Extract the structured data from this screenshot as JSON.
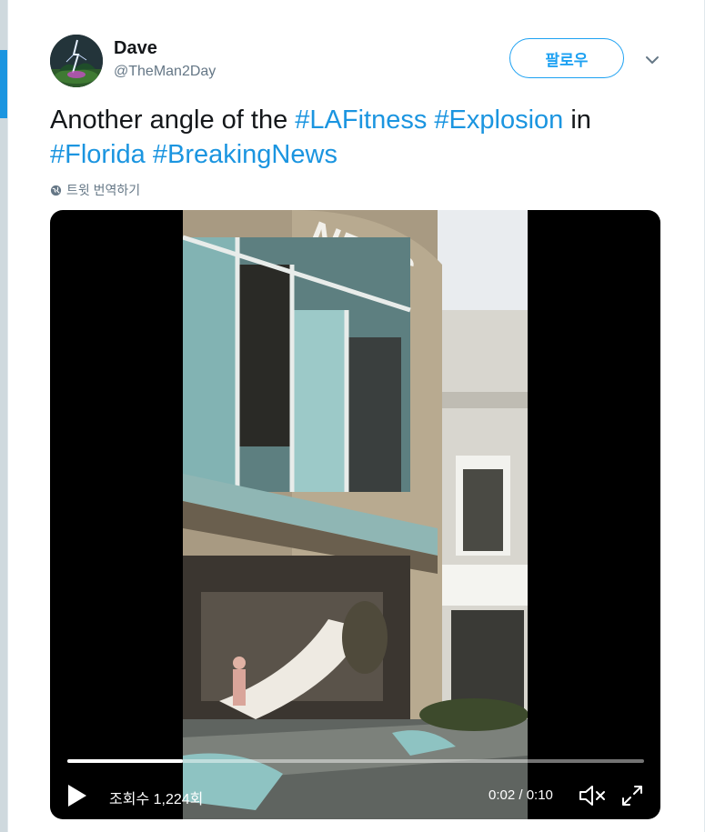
{
  "user": {
    "name": "Dave",
    "handle": "@TheMan2Day",
    "avatar_icon": "avatar-lightning-tree"
  },
  "follow_button": {
    "label": "팔로우"
  },
  "menu": {
    "icon": "chevron-down-icon"
  },
  "tweet": {
    "text_segments": [
      {
        "text": "Another angle of the ",
        "hashtag": false
      },
      {
        "text": "#LAFitness",
        "hashtag": true
      },
      {
        "text": " ",
        "hashtag": false
      },
      {
        "text": "#Explosion",
        "hashtag": true
      },
      {
        "text": " in ",
        "hashtag": false
      },
      {
        "text": "#Florida",
        "hashtag": true
      },
      {
        "text": " ",
        "hashtag": false
      },
      {
        "text": "#BreakingNews",
        "hashtag": true
      }
    ],
    "translate_label": "트윗 번역하기"
  },
  "video": {
    "views_label": "조회수 1,224회",
    "time_label": "0:02 / 0:10",
    "progress": 0.2,
    "sign_text": "NESS"
  },
  "colors": {
    "accent": "#1da1f2",
    "hashtag": "#1b95e0",
    "text": "#14171a",
    "secondary": "#657786"
  }
}
